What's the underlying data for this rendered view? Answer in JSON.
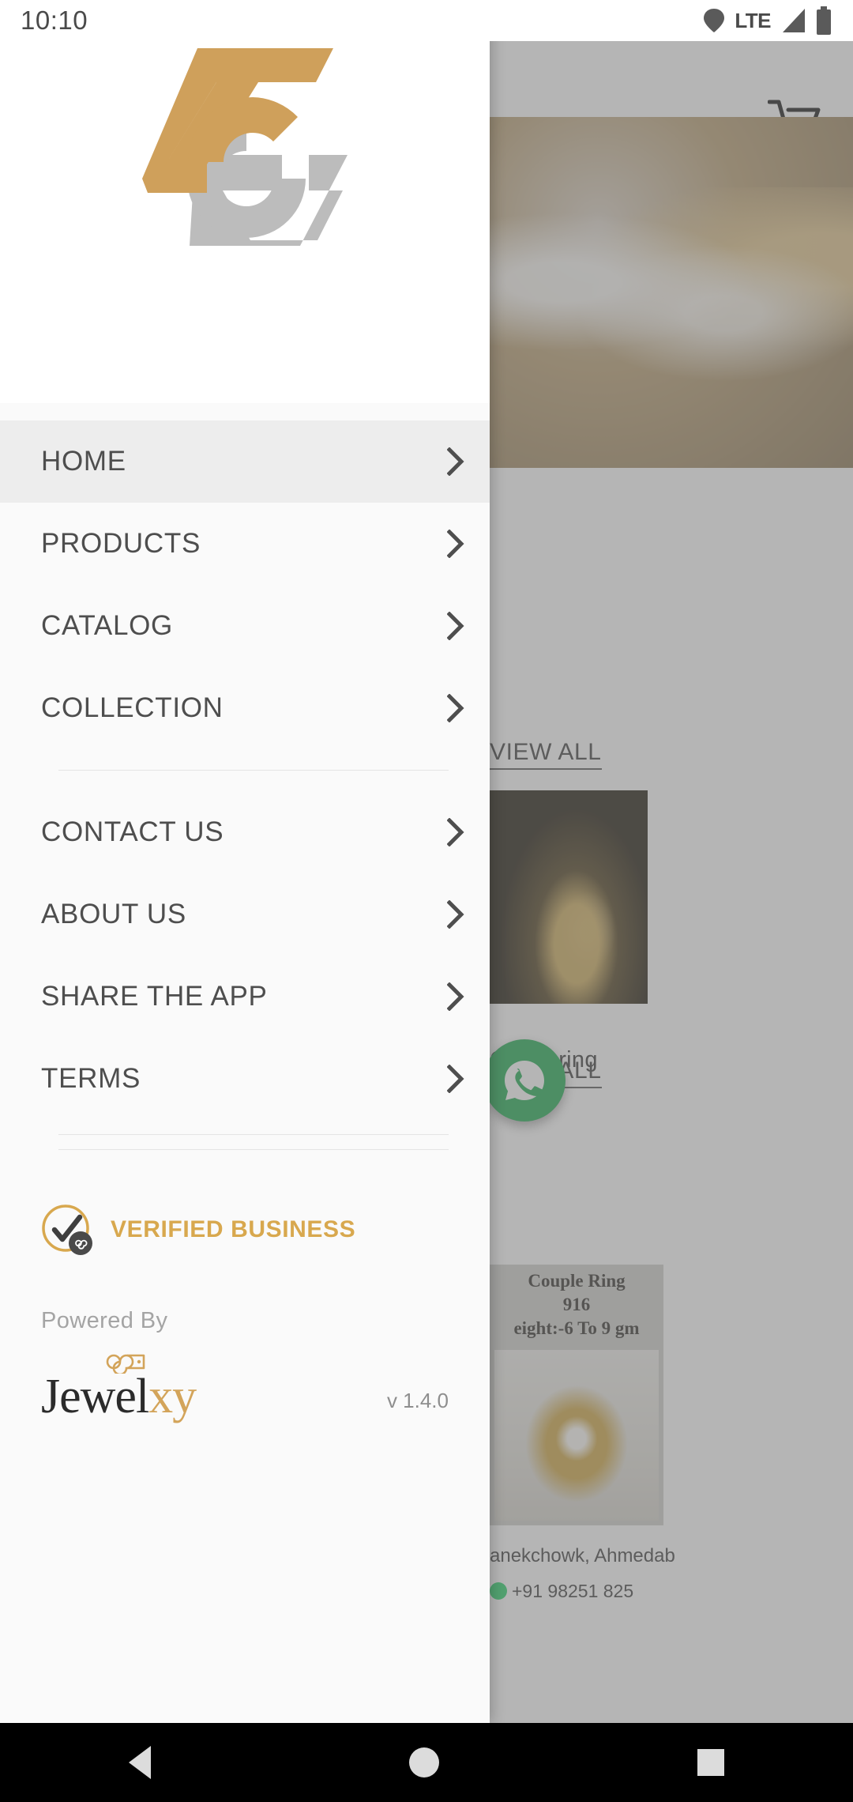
{
  "status_bar": {
    "time": "10:10",
    "network_label": "LTE",
    "icons": [
      "location-icon",
      "signal-icon",
      "battery-icon"
    ]
  },
  "drawer": {
    "logo": {
      "name": "company-logo",
      "gold_color": "#cfa05b",
      "grey_color": "#bcbcbc"
    },
    "menu_groups": [
      {
        "items": [
          {
            "label": "HOME",
            "active": true
          },
          {
            "label": "PRODUCTS",
            "active": false
          },
          {
            "label": "CATALOG",
            "active": false
          },
          {
            "label": "COLLECTION",
            "active": false
          }
        ]
      },
      {
        "items": [
          {
            "label": "CONTACT US",
            "active": false
          },
          {
            "label": "ABOUT US",
            "active": false
          },
          {
            "label": "SHARE THE APP",
            "active": false
          },
          {
            "label": "TERMS",
            "active": false
          }
        ]
      }
    ],
    "verified": {
      "text": "VERIFIED BUSINESS",
      "color": "#d8a84e"
    },
    "footer": {
      "powered_by": "Powered By",
      "brand_part1": "Jewel",
      "brand_part2": "xy",
      "version": "v 1.4.0"
    }
  },
  "background_app": {
    "cart_icon": "shopping-cart-icon",
    "view_all_1": "VIEW ALL",
    "view_all_2": "VIEW ALL",
    "product_name": "Gents ring",
    "product_card": {
      "line1": "Couple Ring",
      "line2": "916",
      "line3": "eight:-6 To 9 gm"
    },
    "shop_address": "anekchowk, Ahmedab",
    "shop_phone": "+91 98251 825",
    "whatsapp_fab": "whatsapp-icon"
  },
  "nav_bar": {
    "back": "back-button",
    "home": "home-button",
    "recents": "recents-button"
  }
}
